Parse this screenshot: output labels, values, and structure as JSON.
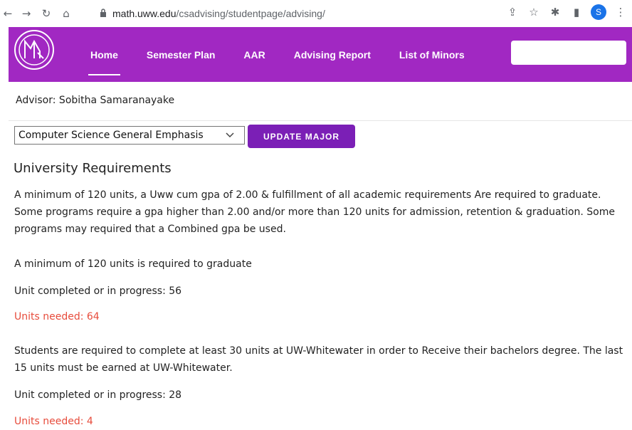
{
  "browser": {
    "url_host": "math.uww.edu",
    "url_path": "/csadvising/studentpage/advising/",
    "profile_initial": "S"
  },
  "nav": {
    "items": [
      "Home",
      "Semester Plan",
      "AAR",
      "Advising Report",
      "List of Minors"
    ]
  },
  "advisor": "Advisor: Sobitha Samaranayake",
  "major": {
    "selected": "Computer Science General Emphasis",
    "update_label": "UPDATE MAJOR"
  },
  "university_requirements": {
    "heading": "University Requirements",
    "intro": "A minimum of 120 units, a Uww cum gpa of 2.00 & fulfillment of all academic requirements Are required to graduate. Some programs require a gpa higher than 2.00 and/or more than 120 units for admission, retention & graduation. Some programs may required that a Combined gpa be used.",
    "req1_text": "A minimum of 120 units is required to graduate",
    "req1_completed": "Unit completed or in progress: 56",
    "req1_needed": "Units needed: 64",
    "req2_text": "Students are required to complete at least 30 units at UW-Whitewater in order to Receive their bachelors degree. The last 15 units must be earned at UW-Whitewater.",
    "req2_completed": "Unit completed or in progress: 28",
    "req2_needed": "Units needed: 4"
  },
  "colors": {
    "header": "#a128c2",
    "button": "#7b1fb6",
    "needed": "#e74c3c"
  }
}
